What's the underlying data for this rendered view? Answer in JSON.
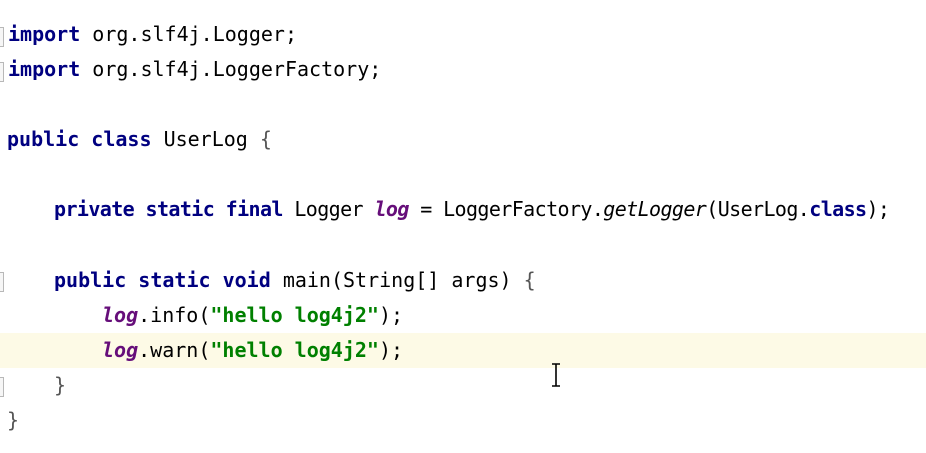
{
  "editor": {
    "current_line_color": "#fdfae6",
    "keyword_color": "#000080",
    "field_color": "#660e7a",
    "string_color": "#008000",
    "lines": {
      "l1": {
        "kw": "import",
        "rest": " org.slf4j.Logger;"
      },
      "l2": {
        "kw": "import",
        "rest": " org.slf4j.LoggerFactory;"
      },
      "l3": {
        "kw1": "public",
        "kw2": "class",
        "name": "UserLog",
        "brace": "{"
      },
      "l4": {
        "kw1": "private",
        "kw2": "static",
        "kw3": "final",
        "type": "Logger",
        "field": "log",
        "eq": " = ",
        "factory": "LoggerFactory.",
        "method": "getLogger",
        "open": "(UserLog.",
        "kw_class": "class",
        "close": ");"
      },
      "l5": {
        "kw1": "public",
        "kw2": "static",
        "kw3": "void",
        "sig": "main(String[] args)",
        "brace": "{"
      },
      "l6": {
        "field": "log",
        "call": ".info(",
        "str": "\"hello log4j2\"",
        "end": ");"
      },
      "l7": {
        "field": "log",
        "call": ".warn(",
        "str": "\"hello log4j2\"",
        "end": ");"
      },
      "l8": {
        "brace": "}"
      },
      "l9": {
        "brace": "}"
      }
    }
  }
}
